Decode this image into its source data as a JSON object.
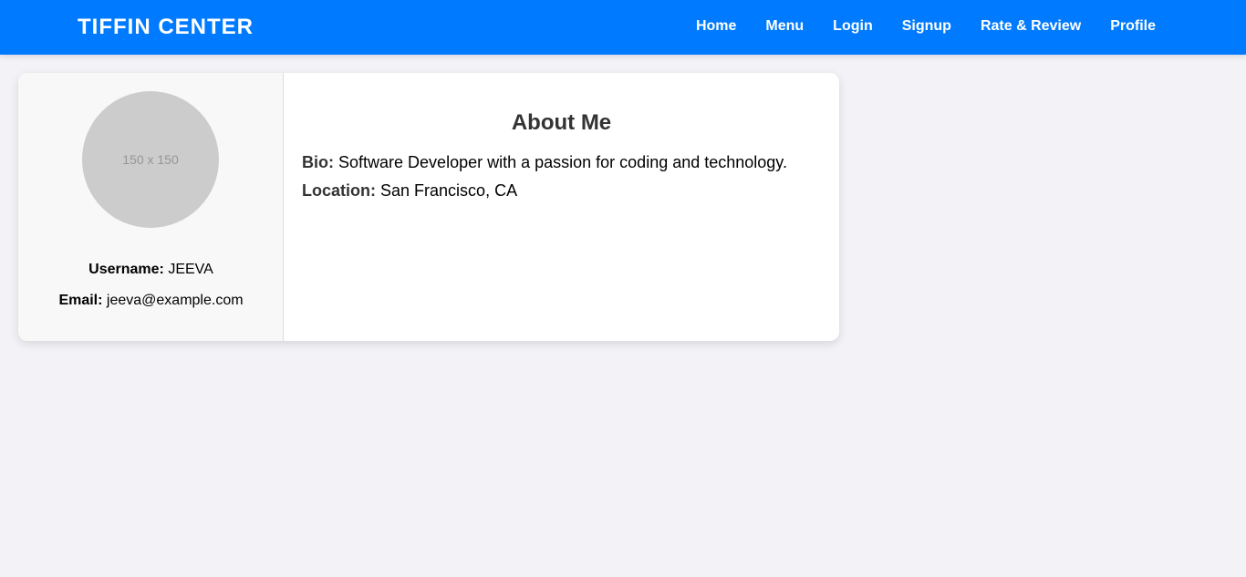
{
  "navbar": {
    "brand": "TIFFIN CENTER",
    "links": [
      "Home",
      "Menu",
      "Login",
      "Signup",
      "Rate & Review",
      "Profile"
    ],
    "background_color": "#007bff"
  },
  "profile": {
    "avatar_placeholder": "150 x 150",
    "username_label": "Username:",
    "username_value": "JEEVA",
    "email_label": "Email:",
    "email_value": "jeeva@example.com"
  },
  "about": {
    "title": "About Me",
    "bio_label": "Bio:",
    "bio_value": "Software Developer with a passion for coding and technology.",
    "location_label": "Location:",
    "location_value": "San Francisco, CA"
  }
}
